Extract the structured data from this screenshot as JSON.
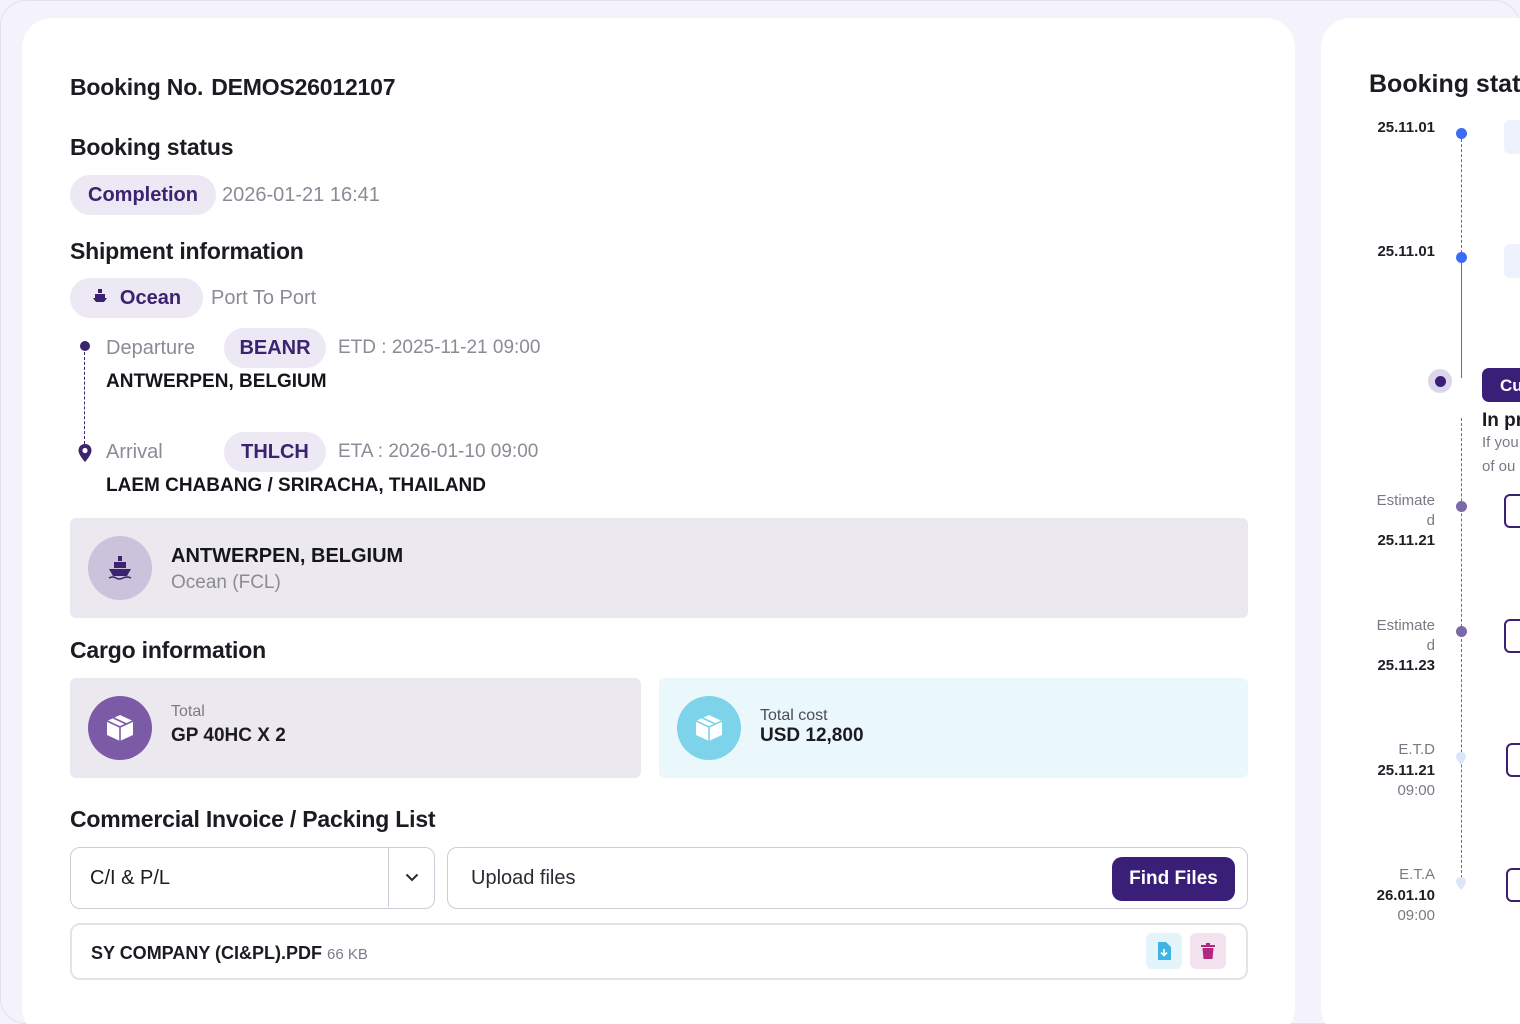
{
  "booking": {
    "label": "Booking No.",
    "number": "DEMOS26012107"
  },
  "status": {
    "title": "Booking status",
    "badge": "Completion",
    "datetime": "2026-01-21 16:41"
  },
  "shipment": {
    "title": "Shipment information",
    "mode": "Ocean",
    "mode_type": "Port To Port",
    "departure": {
      "label": "Departure",
      "code": "BEANR",
      "time": "ETD : 2025-11-21 09:00",
      "place": "ANTWERPEN, BELGIUM"
    },
    "arrival": {
      "label": "Arrival",
      "code": "THLCH",
      "time": "ETA : 2026-01-10 09:00",
      "place": "LAEM CHABANG / SRIRACHA, THAILAND"
    },
    "carrier_card": {
      "place": "ANTWERPEN, BELGIUM",
      "sub": "Ocean (FCL)"
    }
  },
  "cargo": {
    "title": "Cargo information",
    "total_label": "Total",
    "total_value": "GP 40HC X 2",
    "cost_label": "Total cost",
    "cost_value": "USD 12,800"
  },
  "invoice": {
    "title": "Commercial Invoice / Packing List",
    "select_value": "C/I & P/L",
    "upload_placeholder": "Upload files",
    "find_button": "Find Files",
    "file_name": "SY COMPANY (CI&PL).PDF",
    "file_size": "66 KB"
  },
  "right_panel": {
    "title": "Booking stat",
    "timeline": [
      {
        "label": "",
        "date": "25.11.01",
        "time": ""
      },
      {
        "label": "",
        "date": "25.11.01",
        "time": ""
      },
      {
        "label": "Estimate\nd",
        "date": "25.11.21",
        "time": ""
      },
      {
        "label": "Estimate\nd",
        "date": "25.11.23",
        "time": ""
      },
      {
        "label": "E.T.D",
        "date": "25.11.21",
        "time": "09:00"
      },
      {
        "label": "E.T.A",
        "date": "26.01.10",
        "time": "09:00"
      }
    ],
    "current_button": "Cu",
    "in_progress": "In pr",
    "note_line1": "If you",
    "note_line2": "of ou"
  },
  "colors": {
    "primary": "#3a1f78",
    "pill_bg": "#ece8f4",
    "gray_box": "#ebe8f0",
    "cost_box": "#eaf7fb",
    "timeline_blue": "#3b6cf6"
  }
}
